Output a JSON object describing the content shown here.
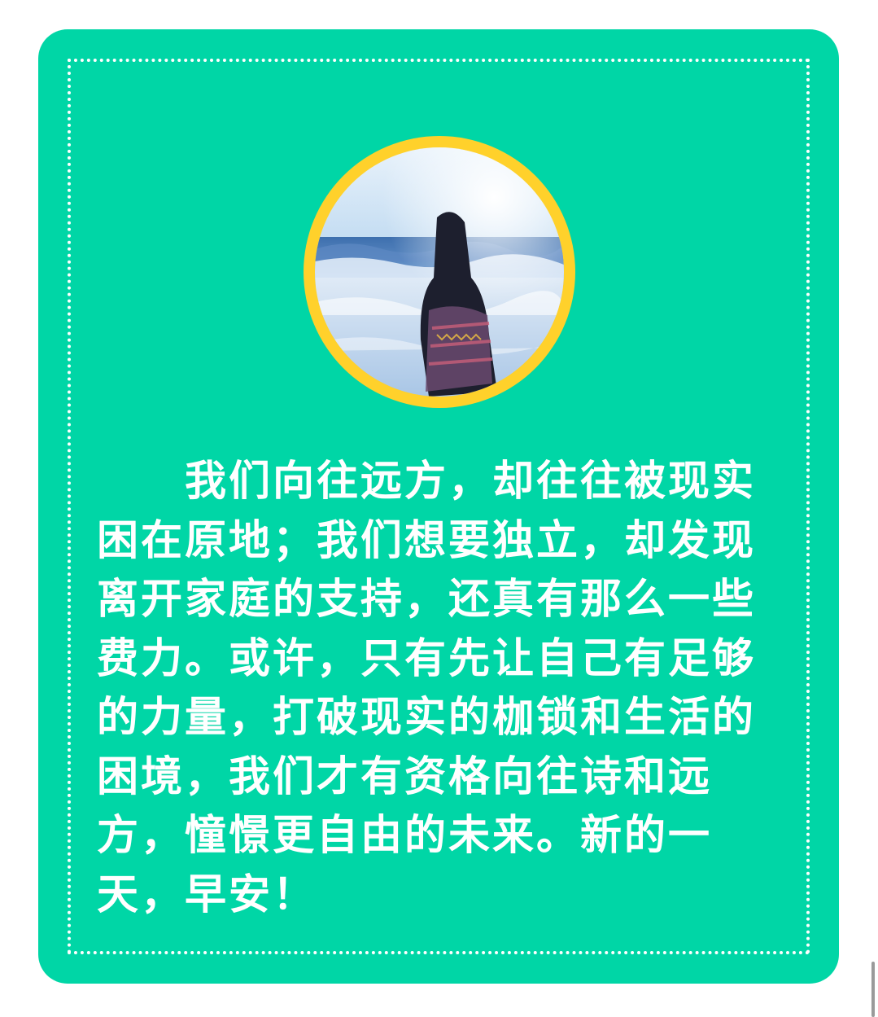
{
  "card": {
    "background_color": "#00d6a6",
    "frame_color": "#ffffff"
  },
  "avatar": {
    "ring_color": "#ffd12b",
    "subject": "person-at-beach-photo"
  },
  "message": {
    "text": "我们向往远方，却往往被现实困在原地；我们想要独立，却发现离开家庭的支持，还真有那么一些费力。或许，只有先让自己有足够的力量，打破现实的枷锁和生活的困境，我们才有资格向往诗和远方，憧憬更自由的未来。新的一天，早安！",
    "color": "#ffffff"
  }
}
